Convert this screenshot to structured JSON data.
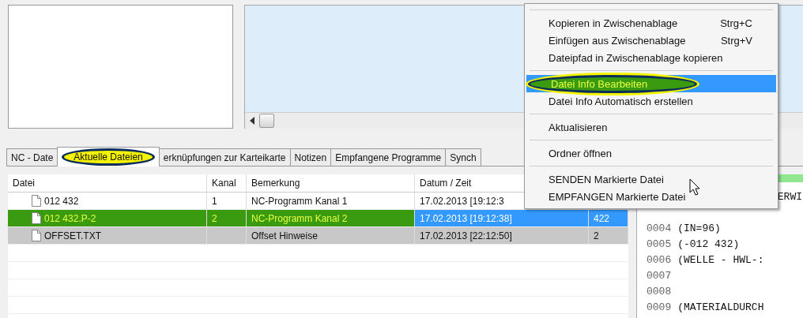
{
  "tabs": [
    {
      "label": "NC - Date",
      "selected": false,
      "annotated": false
    },
    {
      "label": "Aktuelle Dateien",
      "selected": true,
      "annotated": true
    },
    {
      "label": "erknüpfungen zur Karteikarte",
      "selected": false,
      "annotated": false
    },
    {
      "label": "Notizen",
      "selected": false,
      "annotated": false
    },
    {
      "label": "Empfangene Programme",
      "selected": false,
      "annotated": false
    },
    {
      "label": "Synch",
      "selected": false,
      "annotated": false
    }
  ],
  "table": {
    "columns": [
      "Datei",
      "Kanal",
      "Bemerkung",
      "Datum / Zeit"
    ],
    "rows": [
      {
        "file": "012 432",
        "kanal": "1",
        "bemerkung": "NC-Programm Kanal 1",
        "datum": "17.02.2013  [19:12:3",
        "selected": false,
        "marked": false,
        "annotated": false
      },
      {
        "file": "012 432.P-2",
        "kanal": "2",
        "bemerkung": "NC-Programm Kanal 2",
        "datum": "17.02.2013  [19:12:38]",
        "column_5": "422",
        "selected": true,
        "marked": false,
        "annotated": true
      },
      {
        "file": "OFFSET.TXT",
        "bemerkung": "Offset Hinweise",
        "datum": "17.02.2013  [22:12:50]",
        "column_5": "2",
        "selected": false,
        "marked": true,
        "annotated": false
      }
    ]
  },
  "code_lines": [
    {
      "kind": "partial",
      "text": "ERWI"
    },
    {
      "kind": "line",
      "number": "0004",
      "text": "(IN=96)"
    },
    {
      "kind": "line",
      "number": "0005",
      "text": "(-012 432)"
    },
    {
      "kind": "line",
      "number": "0006",
      "text": "(WELLE - HWL-:"
    },
    {
      "kind": "line",
      "number": "0007"
    },
    {
      "kind": "line",
      "number": "0008"
    },
    {
      "kind": "line",
      "number": "0009",
      "text": "(MATERIALDURCH"
    }
  ],
  "context_menu": [
    {
      "kind": "separator"
    },
    {
      "kind": "item",
      "label": "Kopieren in Zwischenablage",
      "shortcut": "Strg+C",
      "selected": false,
      "annotated": false
    },
    {
      "kind": "item",
      "label": "Einfügen aus Zwischenablage",
      "shortcut": "Strg+V",
      "selected": false,
      "annotated": false
    },
    {
      "kind": "item",
      "label": "Dateipfad in Zwischenablage kopieren",
      "selected": false,
      "annotated": false
    },
    {
      "kind": "separator"
    },
    {
      "kind": "item",
      "label": "Datei Info Bearbeiten",
      "selected": true,
      "annotated": true
    },
    {
      "kind": "item",
      "label": "Datei Info Automatisch erstellen",
      "selected": false,
      "annotated": false
    },
    {
      "kind": "separator"
    },
    {
      "kind": "item",
      "label": "Aktualisieren",
      "selected": false,
      "annotated": false
    },
    {
      "kind": "separator"
    },
    {
      "kind": "item",
      "label": "Ordner öffnen",
      "selected": false,
      "annotated": false
    },
    {
      "kind": "separator"
    },
    {
      "kind": "item",
      "label": "SENDEN Markierte Datei",
      "selected": false,
      "annotated": false
    },
    {
      "kind": "item",
      "label": "EMPFANGEN Markierte Datei",
      "selected": false,
      "annotated": false
    }
  ]
}
